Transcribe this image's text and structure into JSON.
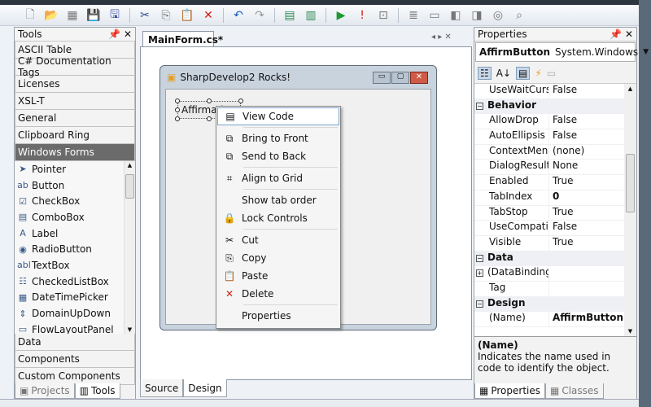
{
  "toolbar": {
    "icons": [
      "new-file-icon",
      "open-folder-icon",
      "add-file-icon",
      "save-icon",
      "save-all-icon",
      "cut-icon",
      "copy-icon",
      "paste-icon",
      "delete-icon",
      "undo-icon",
      "redo-icon",
      "build-icon",
      "build-all-icon",
      "run-icon",
      "debug-stop-icon",
      "stop-icon",
      "comment-icon",
      "bookmark-icon",
      "prev-bookmark-icon",
      "next-bookmark-icon",
      "clear-bookmark-icon",
      "find-icon"
    ]
  },
  "tools": {
    "title": "Tools",
    "categories_top": [
      "ASCII Table",
      "C# Documentation Tags",
      "Licenses",
      "XSL-T",
      "General",
      "Clipboard Ring",
      "Windows Forms"
    ],
    "items": [
      "Pointer",
      "Button",
      "CheckBox",
      "ComboBox",
      "Label",
      "RadioButton",
      "TextBox",
      "CheckedListBox",
      "DateTimePicker",
      "DomainUpDown",
      "FlowLayoutPanel"
    ],
    "categories_bottom": [
      "Data",
      "Components",
      "Custom Components"
    ],
    "tabs": [
      "Projects",
      "Tools"
    ]
  },
  "editor": {
    "tab": "MainForm.cs*",
    "form_title": "SharpDevelop2 Rocks!",
    "button_text": "Affirmative",
    "bottom_tabs": [
      "Source",
      "Design"
    ]
  },
  "context_menu": [
    "View Code",
    "Bring to Front",
    "Send to Back",
    "Align to Grid",
    "Show tab order",
    "Lock Controls",
    "Cut",
    "Copy",
    "Paste",
    "Delete",
    "Properties"
  ],
  "properties": {
    "title": "Properties",
    "object": "AffirmButton",
    "type": "System.Windows",
    "rows": [
      {
        "k": "UseWaitCurso",
        "v": "False"
      },
      {
        "group": "Behavior"
      },
      {
        "k": "AllowDrop",
        "v": "False"
      },
      {
        "k": "AutoEllipsis",
        "v": "False"
      },
      {
        "k": "ContextMenu!",
        "v": "(none)"
      },
      {
        "k": "DialogResult",
        "v": "None"
      },
      {
        "k": "Enabled",
        "v": "True"
      },
      {
        "k": "TabIndex",
        "v": "0",
        "bold": true
      },
      {
        "k": "TabStop",
        "v": "True"
      },
      {
        "k": "UseCompatibl",
        "v": "False"
      },
      {
        "k": "Visible",
        "v": "True"
      },
      {
        "group": "Data"
      },
      {
        "k": "(DataBindings",
        "v": "",
        "expand": true
      },
      {
        "k": "Tag",
        "v": ""
      },
      {
        "group": "Design"
      },
      {
        "k": "(Name)",
        "v": "AffirmButton",
        "bold": true
      }
    ],
    "desc_title": "(Name)",
    "desc_text": "Indicates the name used in code to identify the object.",
    "tabs": [
      "Properties",
      "Classes"
    ]
  }
}
